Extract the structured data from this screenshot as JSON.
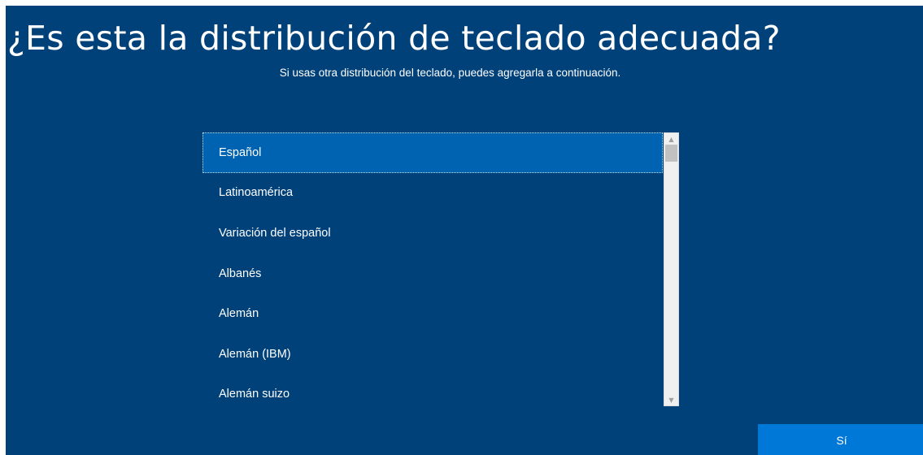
{
  "header": {
    "title": "¿Es esta la distribución de teclado adecuada?",
    "subtitle": "Si usas otra distribución del teclado, puedes agregarla a continuación."
  },
  "layout_list": {
    "selected_index": 0,
    "items": [
      {
        "label": "Español"
      },
      {
        "label": "Latinoamérica"
      },
      {
        "label": "Variación del español"
      },
      {
        "label": "Albanés"
      },
      {
        "label": "Alemán"
      },
      {
        "label": "Alemán (IBM)"
      },
      {
        "label": "Alemán suizo"
      }
    ],
    "scrollbar": {
      "up_icon": "chevron-up-icon",
      "down_icon": "chevron-down-icon"
    }
  },
  "footer": {
    "confirm_label": "Sí"
  },
  "colors": {
    "background": "#00417a",
    "selected_item": "#0063b1",
    "accent_button": "#0078d7",
    "text": "#ffffff"
  }
}
